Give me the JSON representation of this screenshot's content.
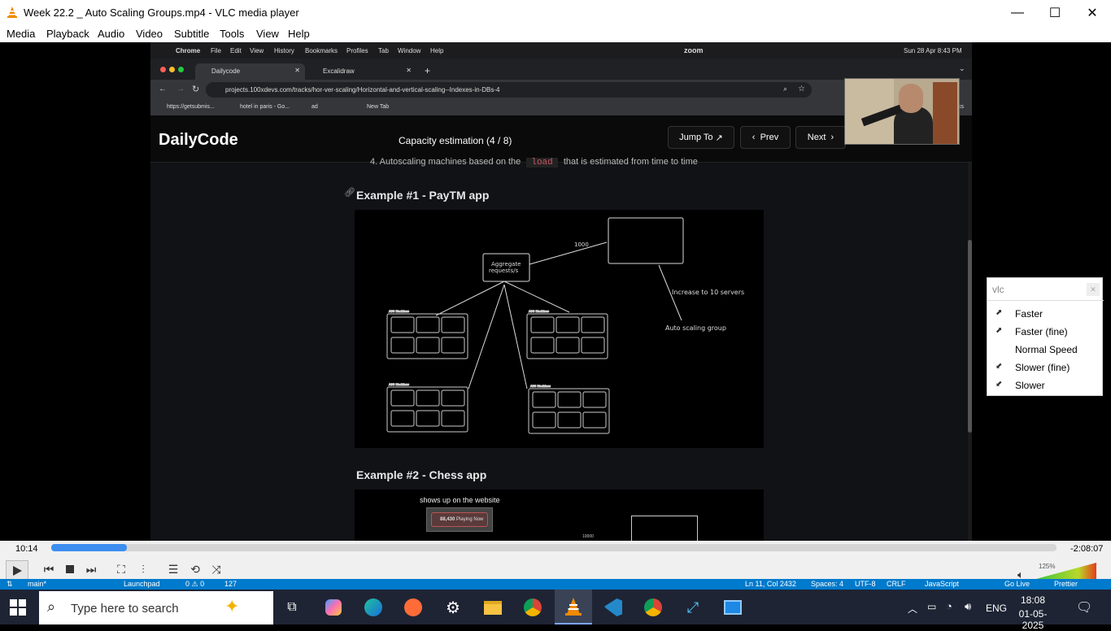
{
  "window": {
    "title": "Week 22.2 _ Auto Scaling Groups.mp4 - VLC media player"
  },
  "menu": [
    "Media",
    "Playback",
    "Audio",
    "Video",
    "Subtitle",
    "Tools",
    "View",
    "Help"
  ],
  "mac_menu": {
    "app": "Chrome",
    "items": [
      "File",
      "Edit",
      "View",
      "History",
      "Bookmarks",
      "Profiles",
      "Tab",
      "Window",
      "Help"
    ],
    "zoom": "zoom",
    "datetime": "Sun 28 Apr  8:43 PM"
  },
  "browser": {
    "tabs": [
      "Dailycode",
      "Excalidraw"
    ],
    "url": "projects.100xdevs.com/tracks/hor-ver-scaling/Horizontal-and-vertical-scaling--Indexes-in-DBs-4",
    "bookmarks": [
      "https://getsubmis...",
      "hotel in paris - Go...",
      "ad",
      "New Tab"
    ],
    "side_text": "ks"
  },
  "site": {
    "logo": "DailyCode",
    "page_title": "Capacity estimation (4 / 8)",
    "jump_to": "Jump To",
    "prev": "Prev",
    "next": "Next",
    "cut_line_a": "4. Autoscaling machines based on the",
    "cut_line_code": "load",
    "cut_line_b": "that is estimated from time to time",
    "example1": "Example #1 - PayTM app",
    "example2": "Example #2 - Chess app",
    "diagram1": {
      "agg_label_1": "Aggregate",
      "agg_label_2": "requests/s",
      "edge_label": "1000",
      "increase_label": "Increase to 10 servers",
      "asg_label": "Auto scaling group",
      "cluster_label": "ASG Machines"
    },
    "diagram2": {
      "caption": "shows up on the website",
      "badge_num": "88,430",
      "badge_text": "Playing Now",
      "partial_num": "10000"
    }
  },
  "popup": {
    "search_placeholder": "vlc",
    "items": [
      "Faster",
      "Faster (fine)",
      "Normal Speed",
      "Slower (fine)",
      "Slower"
    ]
  },
  "player": {
    "current_time": "10:14",
    "remaining_time": "-2:08:07",
    "progress": 0.075,
    "volume_label": "125%",
    "volume": 1.25
  },
  "vscode_status": {
    "branch": "main*",
    "launchpad": "Launchpad",
    "problems": "0 ⚠ 0",
    "count": "127",
    "cursor": "Ln 11, Col 2432",
    "spaces": "Spaces: 4",
    "encoding": "UTF-8",
    "eol": "CRLF",
    "language": "JavaScript",
    "golive": "Go Live",
    "prettier": "Prettier"
  },
  "taskbar": {
    "search_placeholder": "Type here to search",
    "language": "ENG",
    "time": "18:08",
    "date": "01-05-2025"
  },
  "colors": {
    "vlc_orange": "#f08a00",
    "seek_blue": "#3d8ef0",
    "taskbar": "#1e2434",
    "vscode_blue": "#007acc"
  }
}
